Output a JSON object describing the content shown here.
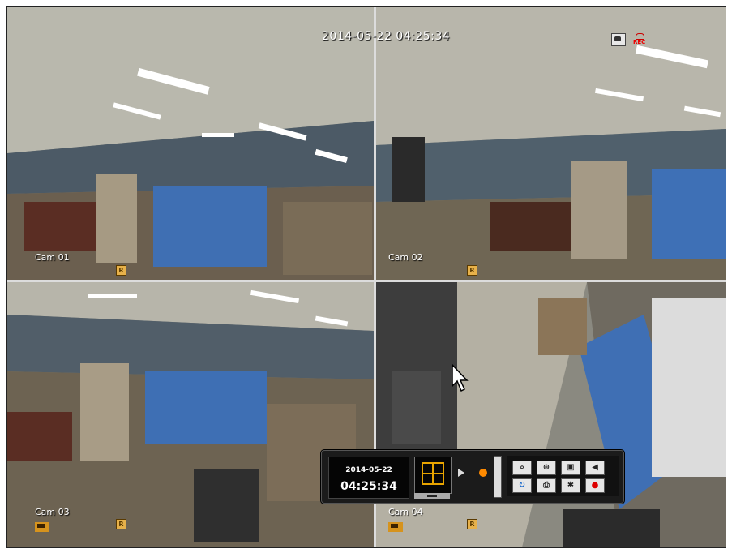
{
  "osd": {
    "datetime": "2014-05-22 04:25:34"
  },
  "cameras": [
    {
      "label": "Cam 01",
      "rec_badge": "R"
    },
    {
      "label": "Cam 02",
      "rec_badge": "R"
    },
    {
      "label": "Cam 03",
      "rec_badge": "R"
    },
    {
      "label": "Cam 04",
      "rec_badge": "R"
    }
  ],
  "status_icons": {
    "rec_label": "REC"
  },
  "panel": {
    "date": "2014-05-22",
    "time": "04:25:34",
    "tools": [
      "zoom-search-icon",
      "zoom-in-icon",
      "snapshot-icon",
      "speaker-icon",
      "refresh-icon",
      "print-icon",
      "settings-icon",
      "record-stop-icon"
    ]
  },
  "colors": {
    "accent": "#ff8a00",
    "rec_badge": "#e7b14a",
    "divider": "#dcdcdc"
  }
}
